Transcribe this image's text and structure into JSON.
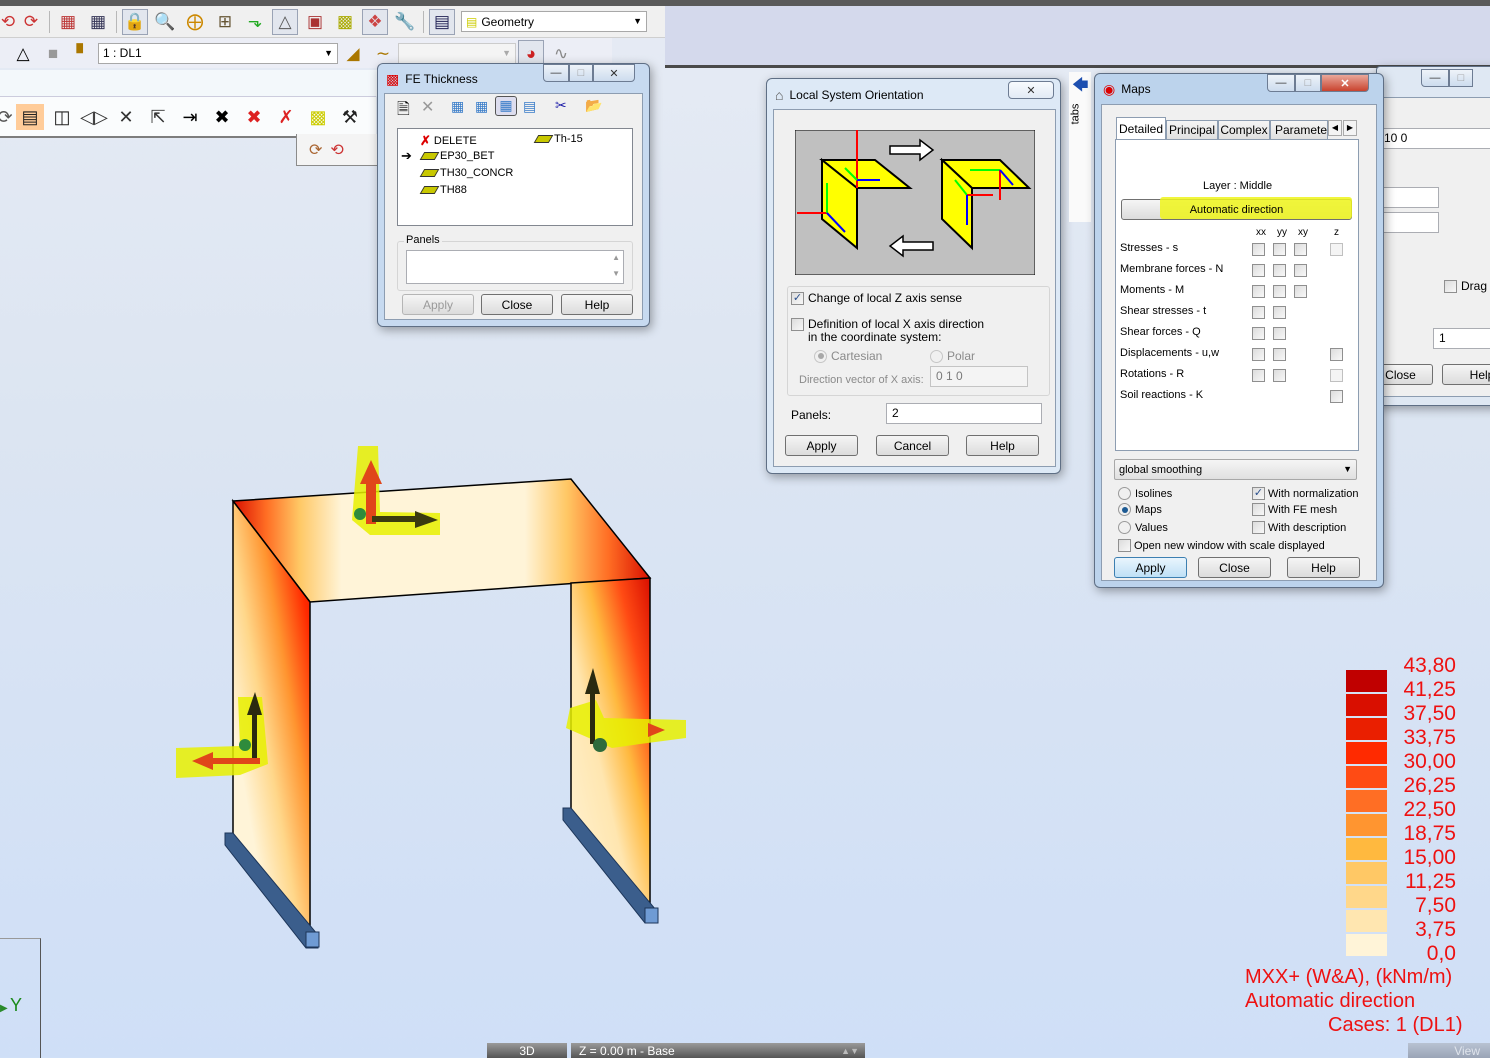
{
  "toolbar1": {
    "icons": [
      "undo-icon",
      "redo-icon",
      "calculator-icon",
      "calculator-settings-icon",
      "lock-icon",
      "zoom-icon",
      "zoom-pan-icon",
      "views-icon",
      "supports-icon",
      "geometry-tools-icon",
      "section-tools-icon",
      "structure-model-icon",
      "3d-view-icon",
      "preferences-icon",
      "layout-icon"
    ],
    "layout_selector": "Geometry"
  },
  "toolbar2": {
    "load_case_selector": "1 : DL1",
    "second_selector": ""
  },
  "view_panel": {
    "title": "View"
  },
  "fe_thickness": {
    "title": "FE Thickness",
    "items": [
      {
        "label": "DELETE",
        "icon": "delete-icon"
      },
      {
        "label": "EP30_BET",
        "icon": "slab-icon",
        "current": true
      },
      {
        "label": "TH30_CONCR",
        "icon": "slab-icon"
      },
      {
        "label": "TH88",
        "icon": "slab-icon"
      },
      {
        "label": "Th-15",
        "icon": "slab-icon"
      }
    ],
    "panels_label": "Panels",
    "panels_value": "",
    "buttons": {
      "apply": "Apply",
      "close": "Close",
      "help": "Help"
    }
  },
  "local_system": {
    "title": "Local System Orientation",
    "change_z_label": "Change of local Z axis sense",
    "change_z_checked": true,
    "def_x_label_1": "Definition of local X axis direction",
    "def_x_label_2": "in the coordinate system:",
    "def_x_checked": false,
    "cartesian_label": "Cartesian",
    "polar_label": "Polar",
    "selected_system": "Cartesian",
    "direction_label": "Direction vector of X axis:",
    "direction_value": "0 1 0",
    "panels_label": "Panels:",
    "panels_value": "2",
    "buttons": {
      "apply": "Apply",
      "cancel": "Cancel",
      "help": "Help"
    }
  },
  "tabs_sidebar": {
    "label": "tabs"
  },
  "maps": {
    "title": "Maps",
    "tabs": [
      "Detailed",
      "Principal",
      "Complex",
      "Parameters"
    ],
    "active_tab": "Detailed",
    "layer_label": "Layer : Middle",
    "direction_button": "Automatic direction",
    "columns": [
      "xx",
      "yy",
      "xy",
      "z"
    ],
    "rows": [
      {
        "label": "Stresses - s",
        "xx": false,
        "yy": false,
        "xy": false,
        "z": false
      },
      {
        "label": "Membrane forces - N",
        "xx": false,
        "yy": false,
        "xy": false
      },
      {
        "label": "Moments - M",
        "xx": false,
        "yy": false,
        "xy": false
      },
      {
        "label": "Shear stresses - t",
        "xx": false,
        "yy": false
      },
      {
        "label": "Shear forces - Q",
        "xx": false,
        "yy": false
      },
      {
        "label": "Displacements - u,w",
        "xx": false,
        "yy": false,
        "z": false
      },
      {
        "label": "Rotations - R",
        "xx": false,
        "yy": false,
        "z": false
      },
      {
        "label": "Soil reactions - K",
        "z": false
      }
    ],
    "smoothing": "global smoothing",
    "display_modes": [
      "Isolines",
      "Maps",
      "Values"
    ],
    "selected_mode": "Maps",
    "options": [
      {
        "label": "With normalization",
        "checked": true
      },
      {
        "label": "With FE mesh",
        "checked": false
      },
      {
        "label": "With description",
        "checked": false
      }
    ],
    "new_window_label": "Open new window with scale displayed",
    "new_window_checked": false,
    "buttons": {
      "apply": "Apply",
      "close": "Close",
      "help": "Help"
    }
  },
  "background_dialog": {
    "field1": "10 0",
    "drag_label": "Drag",
    "field2": "1",
    "close_label": "Close",
    "help_label": "Help"
  },
  "legend": {
    "values": [
      "43,80",
      "41,25",
      "37,50",
      "33,75",
      "30,00",
      "26,25",
      "22,50",
      "18,75",
      "15,00",
      "11,25",
      "7,50",
      "3,75",
      "0,0"
    ],
    "colors": [
      "#c00000",
      "#d90f00",
      "#ea1f00",
      "#ff2a00",
      "#ff4b14",
      "#ff6e24",
      "#ff9530",
      "#ffb93f",
      "#ffc865",
      "#ffd78a",
      "#ffe6b0",
      "#fff4d8"
    ],
    "caption_1": "MXX+ (W&A), (kNm/m)",
    "caption_2": "Automatic direction",
    "caption_3": "Cases: 1 (DL1)",
    "text_color": "#ee1111"
  },
  "axis": {
    "y_label": "Y"
  },
  "statusbar": {
    "view_mode": "3D",
    "level": "Z = 0.00 m - Base",
    "view_button": "View"
  }
}
